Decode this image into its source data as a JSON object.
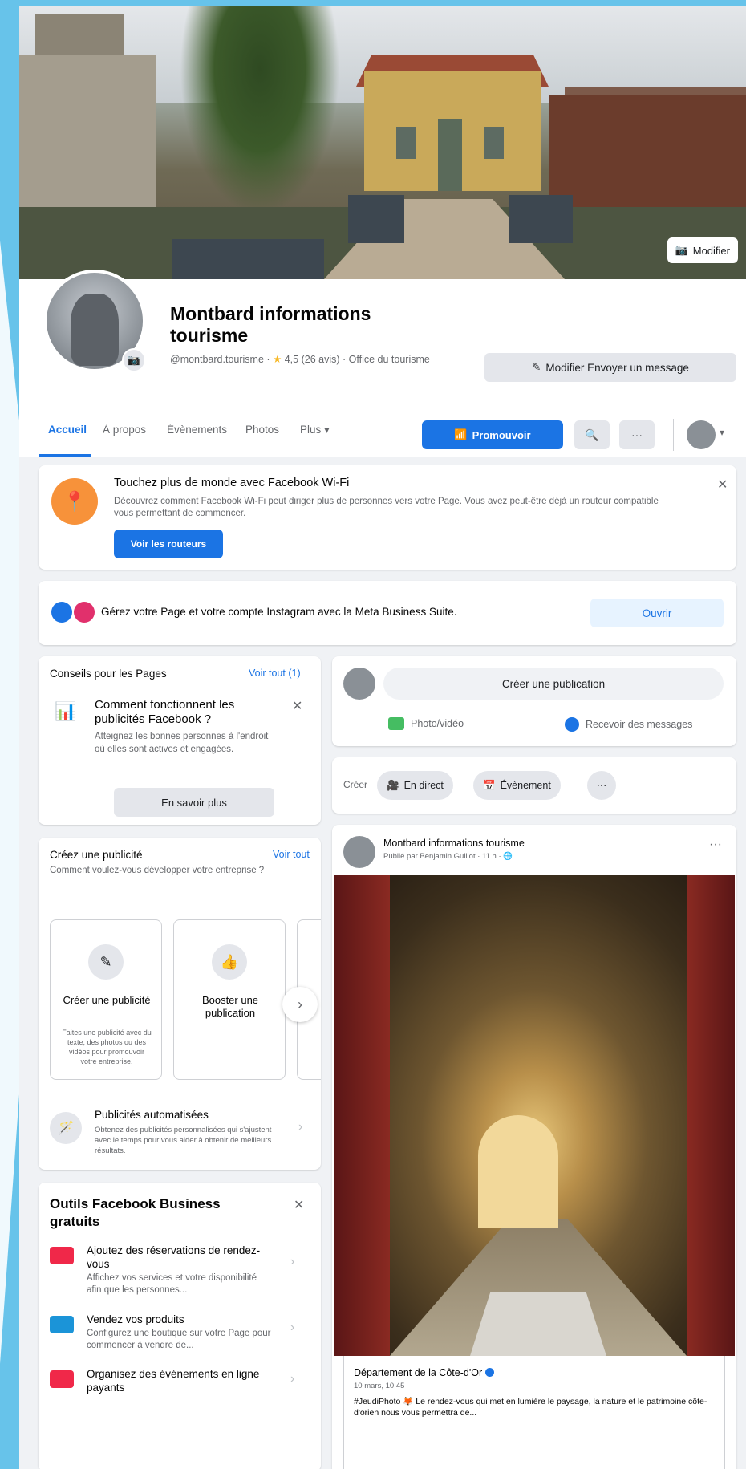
{
  "cover": {
    "edit_label": "Modifier"
  },
  "profile": {
    "name": "Montbard informations tourisme",
    "handle": "@montbard.tourisme",
    "rating": "4,5 (26 avis)",
    "category": "Office du tourisme",
    "message_button": "Modifier Envoyer un message"
  },
  "nav": {
    "tabs": [
      "Accueil",
      "À propos",
      "Évènements",
      "Photos",
      "Plus"
    ],
    "promote_label": "Promouvoir"
  },
  "wifi": {
    "title": "Touchez plus de monde avec Facebook Wi-Fi",
    "description": "Découvrez comment Facebook Wi-Fi peut diriger plus de personnes vers votre Page. Vous avez peut-être déjà un routeur compatible vous permettant de commencer.",
    "button": "Voir les routeurs"
  },
  "meta": {
    "text": "Gérez votre Page et votre compte Instagram avec la Meta Business Suite.",
    "button": "Ouvrir",
    "colors": {
      "meta_blue": "#1b74e4",
      "instagram": "#e1306c"
    }
  },
  "tips": {
    "heading": "Conseils pour les Pages",
    "see_all": "Voir tout (1)",
    "title": "Comment fonctionnent les publicités Facebook ?",
    "description": "Atteignez les bonnes personnes à l'endroit où elles sont actives et engagées.",
    "button": "En savoir plus"
  },
  "ads": {
    "heading": "Créez une publicité",
    "see_all": "Voir tout",
    "subtitle": "Comment voulez-vous développer votre entreprise ?",
    "tiles": [
      {
        "title": "Créer une publicité",
        "desc": "Faites une publicité avec du texte, des photos ou des vidéos pour promouvoir votre entreprise."
      },
      {
        "title": "Booster une publication",
        "desc": ""
      }
    ],
    "auto_title": "Publicités automatisées",
    "auto_desc": "Obtenez des publicités personnalisées qui s'ajustent avec le temps pour vous aider à obtenir de meilleurs résultats."
  },
  "tools": {
    "title": "Outils Facebook Business gratuits",
    "items": [
      {
        "title": "Ajoutez des réservations de rendez-vous",
        "desc": "Affichez vos services et votre disponibilité afin que les personnes..."
      },
      {
        "title": "Vendez vos produits",
        "desc": "Configurez une boutique sur votre Page pour commencer à vendre de..."
      },
      {
        "title": "Organisez des événements en ligne payants",
        "desc": ""
      }
    ]
  },
  "composer": {
    "placeholder": "Créer une publication",
    "photo": "Photo/vidéo",
    "messages": "Recevoir des messages",
    "create_label": "Créer",
    "live": "En direct",
    "event": "Évènement"
  },
  "post": {
    "author": "Montbard informations tourisme",
    "meta": "Publié par Benjamin Guillot · 11 h ·",
    "shared_name": "Département de la Côte-d'Or",
    "shared_date": "10 mars, 10:45 ·",
    "shared_text": "#JeudiPhoto 🦊 Le rendez-vous qui met en lumière le paysage, la nature et le patrimoine côte-d'orien nous vous permettra de..."
  }
}
